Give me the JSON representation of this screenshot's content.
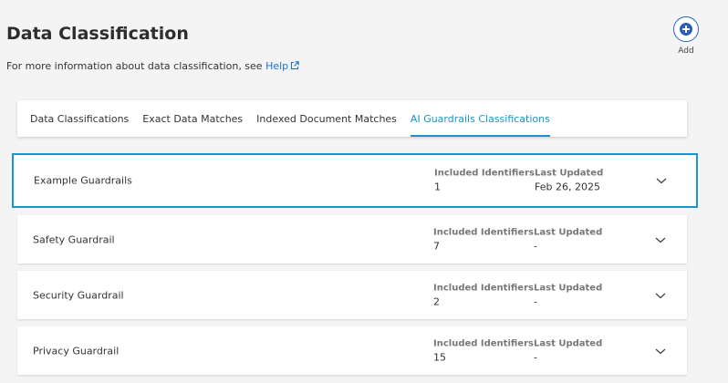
{
  "header": {
    "title": "Data Classification",
    "subtitle_prefix": "For more information about data classification, see ",
    "help_link": "Help",
    "add_label": "Add"
  },
  "tabs": [
    {
      "label": "Data Classifications",
      "active": false
    },
    {
      "label": "Exact Data Matches",
      "active": false
    },
    {
      "label": "Indexed Document Matches",
      "active": false
    },
    {
      "label": "AI Guardrails Classifications",
      "active": true
    }
  ],
  "columns": {
    "identifiers": "Included Identifiers",
    "updated": "Last Updated"
  },
  "rows": [
    {
      "name": "Example Guardrails",
      "identifiers": "1",
      "updated": "Feb 26, 2025",
      "selected": true
    },
    {
      "name": "Safety Guardrail",
      "identifiers": "7",
      "updated": "-",
      "selected": false
    },
    {
      "name": "Security Guardrail",
      "identifiers": "2",
      "updated": "-",
      "selected": false
    },
    {
      "name": "Privacy Guardrail",
      "identifiers": "15",
      "updated": "-",
      "selected": false
    }
  ],
  "colors": {
    "accent": "#1b94c9",
    "link": "#1a73c7",
    "add_button": "#2b5fb9"
  },
  "icons": {
    "add": "plus-circle-icon",
    "external": "external-link-icon",
    "expand": "chevron-down-icon"
  }
}
